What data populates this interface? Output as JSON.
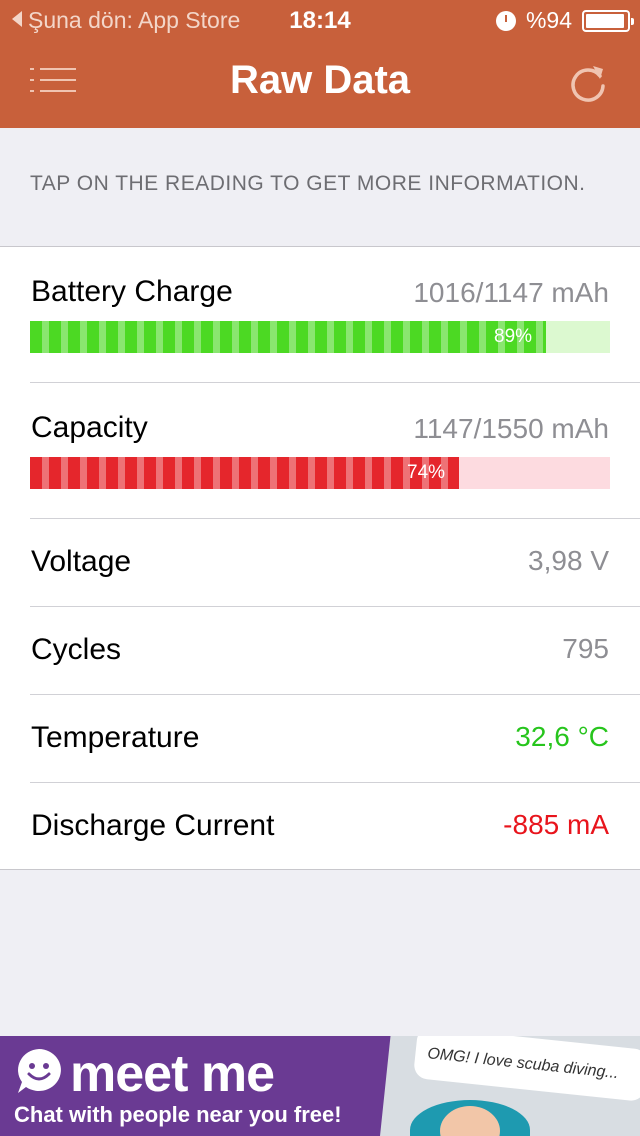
{
  "status_bar": {
    "back_label": "Şuna dön: App Store",
    "time": "18:14",
    "battery_percent": "%94"
  },
  "nav": {
    "title": "Raw Data",
    "menu_icon": "list-icon",
    "refresh_icon": "refresh-icon"
  },
  "hint": "TAP ON THE READING TO GET MORE INFORMATION.",
  "rows": {
    "battery_charge": {
      "label": "Battery Charge",
      "value": "1016/1147 mAh",
      "percent": 89,
      "percent_label": "89%"
    },
    "capacity": {
      "label": "Capacity",
      "value": "1147/1550 mAh",
      "percent": 74,
      "percent_label": "74%"
    },
    "voltage": {
      "label": "Voltage",
      "value": "3,98 V"
    },
    "cycles": {
      "label": "Cycles",
      "value": "795"
    },
    "temperature": {
      "label": "Temperature",
      "value": "32,6 °C"
    },
    "discharge_current": {
      "label": "Discharge Current",
      "value": "-885 mA"
    }
  },
  "colors": {
    "nav_background": "#c8603b",
    "charge_bar": "#4cd923",
    "charge_track": "#dcf9d0",
    "capacity_bar": "#e5262c",
    "capacity_track": "#fddbe0",
    "temperature_value": "#27c51d",
    "discharge_value": "#e8141c"
  },
  "ad": {
    "brand": "meet me",
    "tagline": "Chat with people near you free!",
    "bubble": "OMG! I love scuba diving..."
  }
}
